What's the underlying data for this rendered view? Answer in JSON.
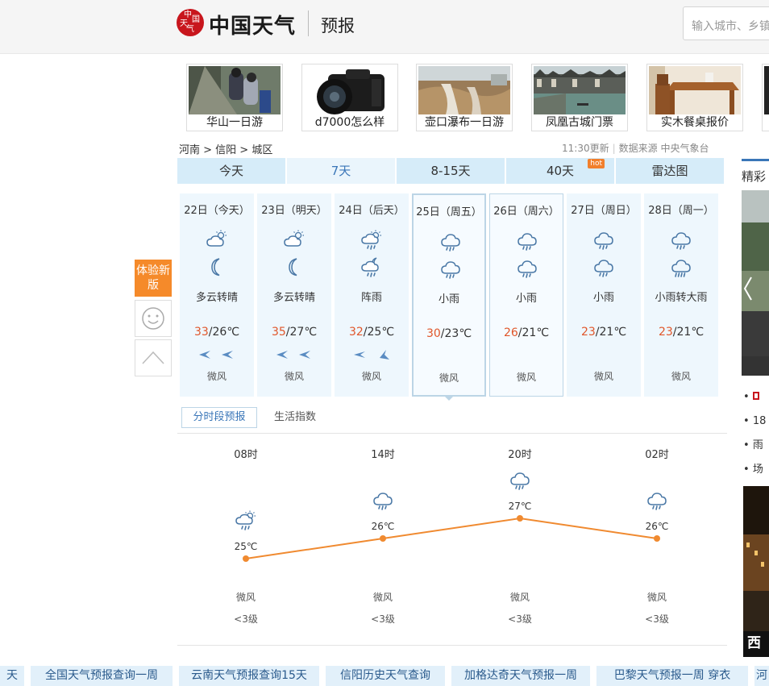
{
  "header": {
    "logo_seal": [
      "中",
      "国",
      "天",
      "气"
    ],
    "logo_text": "中国天气",
    "page_sub": "预报",
    "search_placeholder": "输入城市、乡镇"
  },
  "ads": [
    {
      "caption": "华山一日游"
    },
    {
      "caption": "d7000怎么样"
    },
    {
      "caption": "壶口瀑布一日游"
    },
    {
      "caption": "凤凰古城门票"
    },
    {
      "caption": "实木餐桌报价"
    }
  ],
  "breadcrumb": "河南 > 信阳 > 城区",
  "update": {
    "time": "11:30更新",
    "source": "数据来源 中央气象台"
  },
  "tabs": [
    {
      "label": "今天"
    },
    {
      "label": "7天"
    },
    {
      "label": "8-15天"
    },
    {
      "label": "40天",
      "badge": "hot"
    },
    {
      "label": "雷达图"
    }
  ],
  "days": [
    {
      "date": "22日（今天）",
      "cond": "多云转晴",
      "high": "33",
      "low": "/26℃",
      "wind": "微风",
      "icon1": "partly-cloudy-icon",
      "icon2": "moon-icon"
    },
    {
      "date": "23日（明天）",
      "cond": "多云转晴",
      "high": "35",
      "low": "/27℃",
      "wind": "微风",
      "icon1": "partly-cloudy-icon",
      "icon2": "moon-icon"
    },
    {
      "date": "24日（后天）",
      "cond": "阵雨",
      "high": "32",
      "low": "/25℃",
      "wind": "微风",
      "icon1": "shower-icon",
      "icon2": "shower-night-icon"
    },
    {
      "date": "25日（周五）",
      "cond": "小雨",
      "high": "30",
      "low": "/23℃",
      "wind": "微风",
      "icon1": "rain-icon",
      "icon2": "rain-icon"
    },
    {
      "date": "26日（周六）",
      "cond": "小雨",
      "high": "26",
      "low": "/21℃",
      "wind": "微风",
      "icon1": "rain-icon",
      "icon2": "rain-icon"
    },
    {
      "date": "27日（周日）",
      "cond": "小雨",
      "high": "23",
      "low": "/21℃",
      "wind": "微风",
      "icon1": "rain-icon",
      "icon2": "rain-icon"
    },
    {
      "date": "28日（周一）",
      "cond": "小雨转大雨",
      "high": "23",
      "low": "/21℃",
      "wind": "微风",
      "icon1": "rain-icon",
      "icon2": "heavy-rain-icon"
    }
  ],
  "float": {
    "try_new": "体验新版"
  },
  "subtabs": {
    "hourly": "分时段预报",
    "life": "生活指数"
  },
  "hourly": [
    {
      "time": "08时",
      "temp": "25℃",
      "t": 25,
      "wind": "微风",
      "level": "<3级",
      "icon": "shower-icon"
    },
    {
      "time": "14时",
      "temp": "26℃",
      "t": 26,
      "wind": "微风",
      "level": "<3级",
      "icon": "rain-icon"
    },
    {
      "time": "20时",
      "temp": "27℃",
      "t": 27,
      "wind": "微风",
      "level": "<3级",
      "icon": "rain-icon"
    },
    {
      "time": "02时",
      "temp": "26℃",
      "t": 26,
      "wind": "微风",
      "level": "<3级",
      "icon": "rain-icon"
    }
  ],
  "sidebar": {
    "title": "精彩",
    "list": [
      "18",
      "雨",
      "场"
    ],
    "img_caption": "西"
  },
  "footer_links": [
    "天",
    "全国天气预报查询一周",
    "云南天气预报查询15天",
    "信阳历史天气查询",
    "加格达奇天气预报一周",
    "巴黎天气预报一周 穿衣",
    "河"
  ],
  "colors": {
    "accent": "#3a76b8",
    "line": "#f08a30",
    "high_temp": "#e0562a",
    "tab_bg": "#d6ecf9"
  }
}
